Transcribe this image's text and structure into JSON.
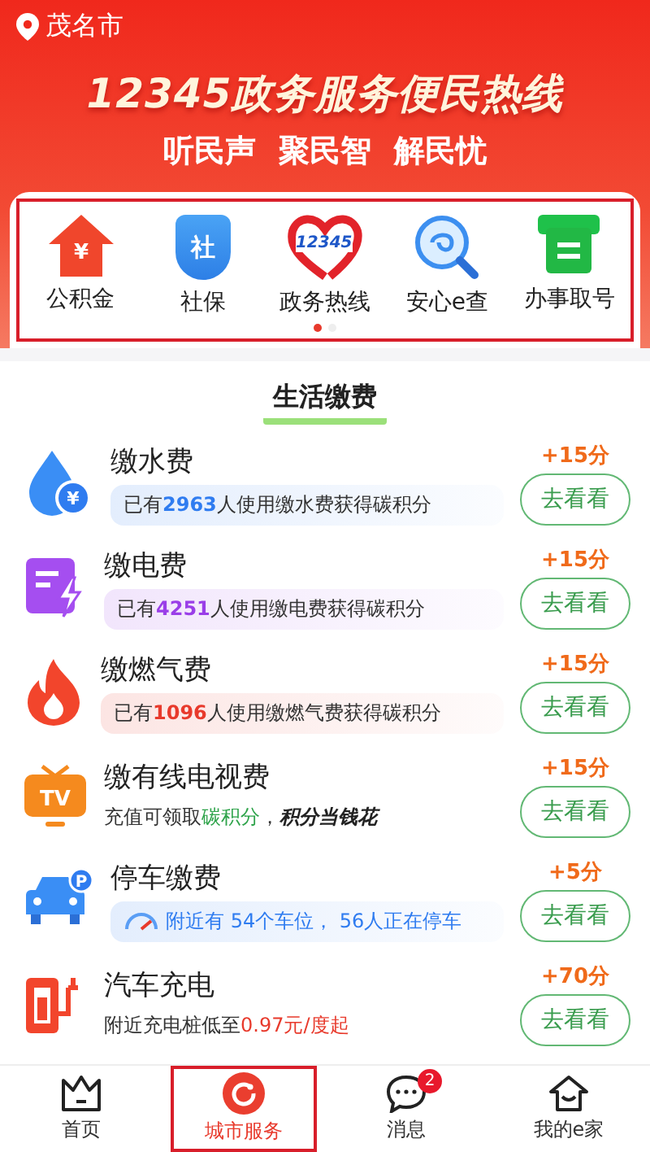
{
  "location": {
    "city": "茂名市"
  },
  "banner": {
    "title": "12345政务服务便民热线",
    "slogans": [
      "听民声",
      "聚民智",
      "解民忧"
    ]
  },
  "services": {
    "highlighted": true,
    "items": [
      {
        "label": "公积金",
        "glyph": "¥"
      },
      {
        "label": "社保",
        "glyph": "社"
      },
      {
        "label": "政务热线",
        "glyph": "12345"
      },
      {
        "label": "安心e查"
      },
      {
        "label": "办事取号"
      }
    ],
    "pages": [
      {
        "selected": true
      },
      {
        "selected": false
      }
    ]
  },
  "section": {
    "title": "生活缴费"
  },
  "payments": [
    {
      "name": "缴水费",
      "glyph": "¥",
      "points": "+15分",
      "action": "去看看",
      "kind": "banner",
      "color": "#2f7cf0",
      "note": "已有**2963**人使用缴水费获得碳积分"
    },
    {
      "name": "缴电费",
      "points": "+15分",
      "action": "去看看",
      "kind": "banner",
      "color": "#9a3ee8",
      "note": "已有**4251**人使用缴电费获得碳积分"
    },
    {
      "name": "缴燃气费",
      "points": "+15分",
      "action": "去看看",
      "kind": "banner",
      "color": "#e83a2c",
      "note": "已有**1096**人使用缴燃气费获得碳积分"
    },
    {
      "name": "缴有线电视费",
      "glyph": "TV",
      "points": "+15分",
      "action": "去看看",
      "kind": "plain",
      "color": "#2ea34a",
      "note": "充值可领取**碳积分**，",
      "tagline": "积分当钱花"
    },
    {
      "name": "停车缴费",
      "glyph": "P",
      "points": "+5分",
      "action": "去看看",
      "kind": "gauge",
      "color": "#2f7cf0",
      "note": "附近有 54个车位， 56人正在停车"
    },
    {
      "name": "汽车充电",
      "points": "+70分",
      "action": "去看看",
      "kind": "plain",
      "color": "#e83a2c",
      "note": "附近充电桩低至**0.97元/度起**"
    }
  ],
  "tabbar": [
    {
      "label": "首页",
      "selected": false,
      "highlighted": false
    },
    {
      "label": "城市服务",
      "selected": true,
      "highlighted": true
    },
    {
      "label": "消息",
      "selected": false,
      "highlighted": false,
      "badge": "2"
    },
    {
      "label": "我的e家",
      "selected": false,
      "highlighted": false
    }
  ]
}
